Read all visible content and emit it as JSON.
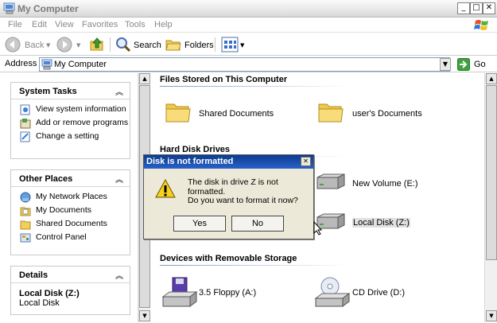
{
  "window": {
    "title": "My Computer"
  },
  "menu": [
    "File",
    "Edit",
    "View",
    "Favorites",
    "Tools",
    "Help"
  ],
  "toolbar": {
    "back": "Back",
    "search": "Search",
    "folders": "Folders"
  },
  "address": {
    "label": "Address",
    "value": "My Computer",
    "go": "Go"
  },
  "system_tasks": {
    "title": "System Tasks",
    "items": [
      "View system information",
      "Add or remove programs",
      "Change a setting"
    ]
  },
  "other_places": {
    "title": "Other Places",
    "items": [
      "My Network Places",
      "My Documents",
      "Shared Documents",
      "Control Panel"
    ]
  },
  "details": {
    "title": "Details",
    "name": "Local Disk (Z:)",
    "type": "Local Disk"
  },
  "groups": {
    "files": {
      "title": "Files Stored on This Computer",
      "items": [
        "Shared Documents",
        "user's Documents"
      ]
    },
    "hdd": {
      "title": "Hard Disk Drives",
      "items": [
        "New Volume (E:)",
        "Local Disk (Z:)"
      ]
    },
    "removable": {
      "title": "Devices with Removable Storage",
      "items": [
        "3.5 Floppy (A:)",
        "CD Drive (D:)"
      ]
    }
  },
  "dialog": {
    "title": "Disk is not formatted",
    "message1": "The disk in drive Z is not formatted.",
    "message2": "Do you want to format it now?",
    "yes": "Yes",
    "no": "No"
  }
}
